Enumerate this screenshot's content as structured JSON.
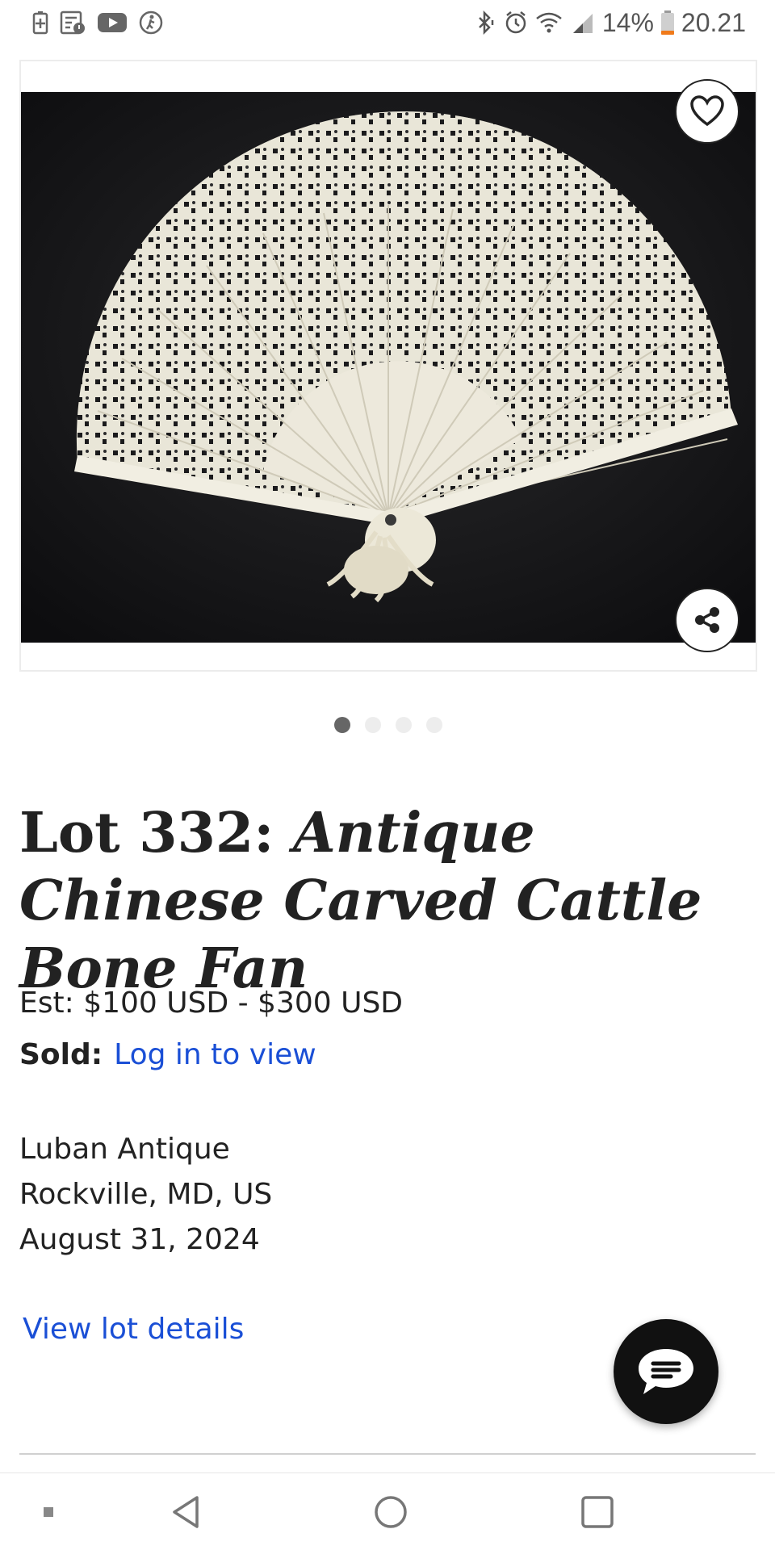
{
  "status_bar": {
    "battery_percent": "14%",
    "time": "20.21"
  },
  "carousel": {
    "image_count": 4,
    "active_index": 0
  },
  "lot": {
    "prefix": "Lot 332:",
    "name": "Antique Chinese Carved Cattle Bone Fan",
    "estimate": "Est: $100 USD - $300 USD",
    "sold_label": "Sold:",
    "sold_link": "Log in to view",
    "auction_house": "Luban Antique",
    "location": "Rockville, MD, US",
    "date": "August 31, 2024",
    "details_link": "View lot details"
  },
  "colors": {
    "link": "#1a4fd6",
    "text": "#222222",
    "chat_button": "#111111",
    "battery_low": "#f07a1a"
  },
  "icons": {
    "favorite": "heart-icon",
    "share": "share-icon",
    "chat": "chat-icon",
    "nav_back": "back-icon",
    "nav_home": "home-icon",
    "nav_recents": "recents-icon"
  }
}
